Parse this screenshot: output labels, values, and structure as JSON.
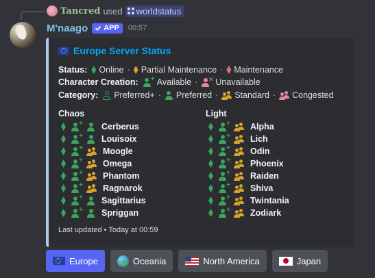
{
  "reply": {
    "user": "Tancred",
    "used": "used",
    "command": "worldstatus"
  },
  "message": {
    "author": "M'naago",
    "app_tag": "APP",
    "time": "00:57"
  },
  "embed": {
    "title": "Europe Server Status",
    "accent_color": "#aaccea",
    "status_legend": {
      "label": "Status:",
      "online": "Online",
      "partial": "Partial Maintenance",
      "maintenance": "Maintenance",
      "separator": "·"
    },
    "creation_legend": {
      "label": "Character Creation:",
      "available": "Available",
      "unavailable": "Unavailable",
      "separator": "·"
    },
    "category_legend": {
      "label": "Category:",
      "preferred_plus": "Preferred+",
      "preferred": "Preferred",
      "standard": "Standard",
      "congested": "Congested",
      "separator": "·"
    },
    "datacenters": [
      {
        "name": "Chaos",
        "servers": [
          {
            "name": "Cerberus",
            "status": "online",
            "creation": "available",
            "category": "preferred"
          },
          {
            "name": "Louisoix",
            "status": "online",
            "creation": "available",
            "category": "preferred"
          },
          {
            "name": "Moogle",
            "status": "online",
            "creation": "available",
            "category": "standard"
          },
          {
            "name": "Omega",
            "status": "online",
            "creation": "available",
            "category": "standard"
          },
          {
            "name": "Phantom",
            "status": "online",
            "creation": "available",
            "category": "standard"
          },
          {
            "name": "Ragnarok",
            "status": "online",
            "creation": "available",
            "category": "standard"
          },
          {
            "name": "Sagittarius",
            "status": "online",
            "creation": "available",
            "category": "preferred"
          },
          {
            "name": "Spriggan",
            "status": "online",
            "creation": "available",
            "category": "preferred"
          }
        ]
      },
      {
        "name": "Light",
        "servers": [
          {
            "name": "Alpha",
            "status": "online",
            "creation": "available",
            "category": "standard"
          },
          {
            "name": "Lich",
            "status": "online",
            "creation": "available",
            "category": "standard"
          },
          {
            "name": "Odin",
            "status": "online",
            "creation": "available",
            "category": "standard"
          },
          {
            "name": "Phoenix",
            "status": "online",
            "creation": "available",
            "category": "standard"
          },
          {
            "name": "Raiden",
            "status": "online",
            "creation": "available",
            "category": "standard"
          },
          {
            "name": "Shiva",
            "status": "online",
            "creation": "available",
            "category": "standard"
          },
          {
            "name": "Twintania",
            "status": "online",
            "creation": "available",
            "category": "standard"
          },
          {
            "name": "Zodiark",
            "status": "online",
            "creation": "available",
            "category": "standard"
          }
        ]
      }
    ],
    "footer": "Last updated • Today at 00:59"
  },
  "buttons": [
    {
      "label": "Europe",
      "icon": "eu-flag-icon",
      "active": true
    },
    {
      "label": "Oceania",
      "icon": "globe-icon",
      "active": false
    },
    {
      "label": "North America",
      "icon": "us-flag-icon",
      "active": false
    },
    {
      "label": "Japan",
      "icon": "jp-flag-icon",
      "active": false
    }
  ],
  "colors": {
    "online": "#3ba55d",
    "partial": "#d7a32b",
    "maintenance": "#e0707f",
    "primary_button": "#5865f2",
    "link_title": "#00a8fc"
  }
}
